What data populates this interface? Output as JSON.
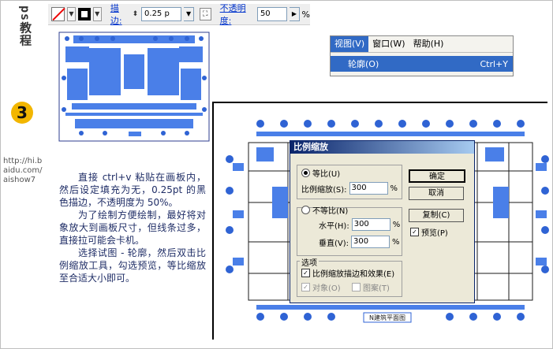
{
  "brand": {
    "text": "ps教程",
    "number": "3"
  },
  "url": {
    "lines": [
      "http://hi.b",
      "aidu.com/",
      "aishow7"
    ]
  },
  "toolbar": {
    "stroke_label": "描边:",
    "stroke_value": "0.25 p",
    "opacity_label": "不透明度:",
    "opacity_value": "50",
    "opacity_unit": "%"
  },
  "menu": {
    "items": [
      "视图(V)",
      "窗口(W)",
      "帮助(H)"
    ],
    "dropdown_item": "轮廓(O)",
    "dropdown_shortcut": "Ctrl+Y"
  },
  "instructions": {
    "p1": "直接 ctrl+v 粘贴在画板内，然后设定填充为无，0.25pt 的黑色描边，不透明度为 50%。",
    "p2": "为了绘制方便绘制，最好将对象放大到画板尺寸，但线条过多，直接拉可能会卡机。",
    "p3": "选择试图 - 轮廓，然后双击比例缩放工具，勾选预览，等比缩放至合适大小即可。"
  },
  "dialog": {
    "title": "比例缩放",
    "uniform_label": "等比(U)",
    "scale_label": "比例缩放(S):",
    "scale_value": "300",
    "nonuniform_label": "不等比(N)",
    "horizontal_label": "水平(H):",
    "horizontal_value": "300",
    "vertical_label": "垂直(V):",
    "vertical_value": "300",
    "pct": "%",
    "ok": "确定",
    "cancel": "取消",
    "copy": "复制(C)",
    "preview": "预览(P)",
    "options_title": "选项",
    "scale_strokes": "比例缩放描边和效果(E)",
    "objects": "对象(O)",
    "patterns": "图案(T)"
  },
  "art_caption": "N建筑平面图"
}
